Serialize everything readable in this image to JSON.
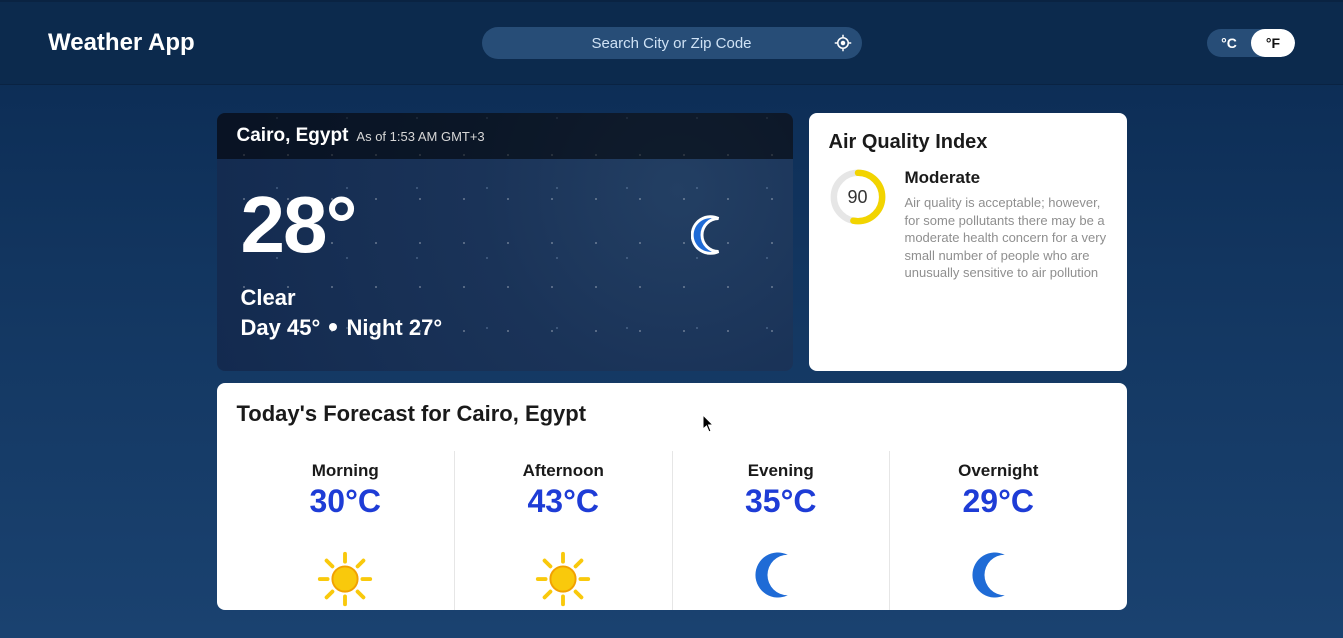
{
  "app": {
    "title": "Weather App"
  },
  "search": {
    "placeholder": "Search City or Zip Code"
  },
  "units": {
    "c": "°C",
    "f": "°F",
    "active": "f"
  },
  "current": {
    "location": "Cairo, Egypt",
    "as_of": "As of 1:53 AM GMT+3",
    "temp": "28°",
    "condition": "Clear",
    "day_label": "Day",
    "day_temp": "45°",
    "night_label": "Night",
    "night_temp": "27°"
  },
  "aqi": {
    "title": "Air Quality Index",
    "value": "90",
    "label": "Moderate",
    "description": "Air quality is acceptable; however, for some pollutants there may be a moderate health concern for a very small number of people who are unusually sensitive to air pollution",
    "ring_color": "#f2d400",
    "ring_pct": 53
  },
  "forecast": {
    "title": "Today's Forecast for Cairo, Egypt",
    "parts": [
      {
        "label": "Morning",
        "temp": "30°C",
        "icon": "sun",
        "bold": false
      },
      {
        "label": "Afternoon",
        "temp": "43°C",
        "icon": "sun",
        "bold": false
      },
      {
        "label": "Evening",
        "temp": "35°C",
        "icon": "moon",
        "bold": false
      },
      {
        "label": "Overnight",
        "temp": "29°C",
        "icon": "moon",
        "bold": true
      }
    ]
  }
}
